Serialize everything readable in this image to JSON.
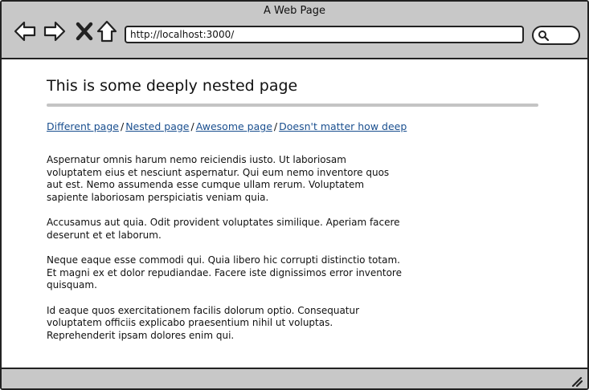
{
  "window": {
    "title": "A Web Page"
  },
  "toolbar": {
    "back_icon": "back-arrow-icon",
    "forward_icon": "forward-arrow-icon",
    "stop_icon": "close-icon",
    "home_icon": "home-icon",
    "address": "http://localhost:3000/",
    "search_icon": "search-icon"
  },
  "page": {
    "title": "This is some deeply nested page",
    "breadcrumb": [
      {
        "label": "Different page"
      },
      {
        "label": "Nested page"
      },
      {
        "label": "Awesome page"
      },
      {
        "label": "Doesn't matter how deep"
      }
    ],
    "breadcrumb_separator": "/",
    "paragraphs": [
      "Aspernatur omnis harum nemo reiciendis iusto. Ut laboriosam voluptatem eius et nesciunt aspernatur. Qui eum nemo inventore quos aut est. Nemo assumenda esse cumque ullam rerum. Voluptatem sapiente laboriosam perspiciatis veniam quia.",
      "Accusamus aut quia. Odit provident voluptates similique. Aperiam facere deserunt et et laborum.",
      "Neque eaque esse commodi qui. Quia libero hic corrupti distinctio totam. Et magni ex et dolor repudiandae. Facere iste dignissimos error inventore quisquam.",
      "Id eaque quos exercitationem facilis dolorum optio. Consequatur voluptatem officiis explicabo praesentium nihil ut voluptas. Reprehenderit ipsam dolores enim qui."
    ]
  },
  "colors": {
    "chrome": "#c8c8c8",
    "link": "#1a4f8f",
    "rule": "#c4c4c4"
  }
}
